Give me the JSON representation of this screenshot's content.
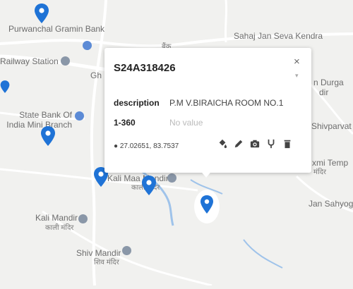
{
  "map_labels": {
    "purwanchal_gramin_bank": "Purwanchal Gramin Bank",
    "railway_station": "Railway Station",
    "sahaj_jan_seva_kendra": "Sahaj Jan Seva Kendra",
    "durga_line1": "n Durga",
    "durga_line2": "dir",
    "sbi_line1": "State Bank Of",
    "sbi_line2": "India Mini Branch",
    "shivparvati": "Shivparvat",
    "laxmi_line1": "xmi Temp",
    "laxmi_line2": "मंदिर",
    "kali_maa_mandir": "Kali Maa Mandir",
    "kali_maa_hindi": "काली मंदिर",
    "jan_sahyog": "Jan Sahyog",
    "kali_mandir": "Kali Mandir",
    "kali_mandir_hindi": "काली मंदिर",
    "shiv_mandir": "Shiv Mandir",
    "shiv_mandir_hindi": "शिव मंदिर",
    "gh": "Gh",
    "road_shield": "बैंक"
  },
  "popup": {
    "title": "S24A318426",
    "close_label": "×",
    "fields": [
      {
        "key": "description",
        "value": "P.M V.BIRAICHA ROOM NO.1"
      },
      {
        "key": "1-360",
        "value": "No value"
      }
    ],
    "coordinates": "27.02651, 83.7537"
  },
  "icons": [
    "location-pin-icon",
    "paint-bucket-icon",
    "pencil-icon",
    "camera-icon",
    "branch-icon",
    "trash-icon",
    "close-icon"
  ],
  "colors": {
    "marker": "#1f73d6",
    "road": "#ffffff",
    "water": "#9fc3ea",
    "poi_blue": "#5c8bd6"
  }
}
